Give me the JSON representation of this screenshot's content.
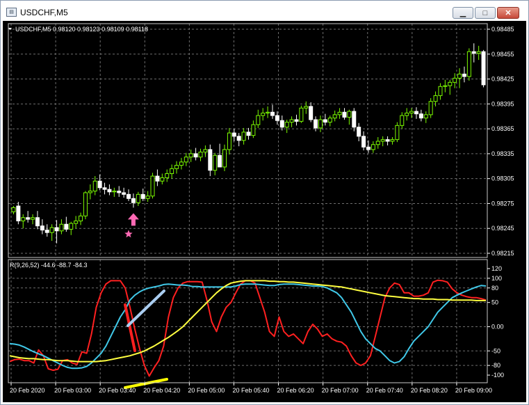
{
  "window": {
    "title": "USDCHF,M5",
    "buttons": [
      "minimize",
      "maximize",
      "close"
    ]
  },
  "main_header": "USDCHF,M5  0.98120 0.98123 0.98109 0.98118",
  "indicator_header": "R(9,26,52) -44.6 -88.7 -84.3",
  "colors": {
    "background": "#000000",
    "bull_candle": "#7cfc00",
    "bear_candle": "#ffffff",
    "grid": "#6e6e6e",
    "line_red": "#ff2020",
    "line_cyan": "#40c8e8",
    "line_yellow": "#ffff40",
    "arrow": "#ff69b4",
    "annot_red": "#ff2020",
    "annot_blue": "#aacdf0",
    "annot_yellow": "#ffff00"
  },
  "icons": {
    "arrow": "pink-up-arrow-icon",
    "star": "pink-star-icon",
    "dropdown": "triangle-down-icon"
  },
  "chart_data": [
    {
      "type": "candlestick",
      "symbol": "USDCHF",
      "timeframe": "M5",
      "ylim": [
        0.98215,
        0.98485
      ],
      "y_ticks": [
        "0.98485",
        "0.98455",
        "0.98425",
        "0.98395",
        "0.98365",
        "0.98335",
        "0.98305",
        "0.98275",
        "0.98245",
        "0.98215"
      ],
      "candles": [
        [
          0.98265,
          0.98272,
          0.98262,
          0.9827
        ],
        [
          0.98272,
          0.98277,
          0.9825,
          0.98254
        ],
        [
          0.98254,
          0.98262,
          0.98245,
          0.98258
        ],
        [
          0.98258,
          0.98266,
          0.98252,
          0.98256
        ],
        [
          0.98256,
          0.98262,
          0.9825,
          0.98258
        ],
        [
          0.98258,
          0.98266,
          0.98244,
          0.98248
        ],
        [
          0.98248,
          0.98256,
          0.98238,
          0.98243
        ],
        [
          0.98243,
          0.9825,
          0.98235,
          0.9824
        ],
        [
          0.9824,
          0.9825,
          0.9823,
          0.98246
        ],
        [
          0.98246,
          0.98255,
          0.98227,
          0.98242
        ],
        [
          0.98242,
          0.98256,
          0.98238,
          0.9825
        ],
        [
          0.9825,
          0.98259,
          0.98241,
          0.98244
        ],
        [
          0.98244,
          0.98253,
          0.98237,
          0.98251
        ],
        [
          0.98251,
          0.9826,
          0.98245,
          0.98254
        ],
        [
          0.98254,
          0.98264,
          0.98249,
          0.9826
        ],
        [
          0.9826,
          0.9829,
          0.98256,
          0.98288
        ],
        [
          0.98288,
          0.98298,
          0.9828,
          0.9829
        ],
        [
          0.9829,
          0.98308,
          0.98285,
          0.98302
        ],
        [
          0.98302,
          0.9831,
          0.98291,
          0.98294
        ],
        [
          0.98294,
          0.983,
          0.98286,
          0.98292
        ],
        [
          0.98292,
          0.98298,
          0.98285,
          0.98289
        ],
        [
          0.98289,
          0.98294,
          0.98283,
          0.9829
        ],
        [
          0.9829,
          0.98296,
          0.98283,
          0.98288
        ],
        [
          0.98288,
          0.98294,
          0.98282,
          0.98286
        ],
        [
          0.98286,
          0.98292,
          0.98278,
          0.98281
        ],
        [
          0.98281,
          0.98287,
          0.9827,
          0.98276
        ],
        [
          0.98276,
          0.98289,
          0.98272,
          0.98286
        ],
        [
          0.98286,
          0.98293,
          0.98278,
          0.98281
        ],
        [
          0.98281,
          0.9829,
          0.98277,
          0.98284
        ],
        [
          0.98284,
          0.98312,
          0.98281,
          0.98308
        ],
        [
          0.98308,
          0.98316,
          0.98296,
          0.98302
        ],
        [
          0.98302,
          0.98311,
          0.98298,
          0.98306
        ],
        [
          0.98306,
          0.98316,
          0.98301,
          0.98311
        ],
        [
          0.98311,
          0.98322,
          0.98305,
          0.98317
        ],
        [
          0.98317,
          0.98326,
          0.98311,
          0.98321
        ],
        [
          0.98321,
          0.9833,
          0.98316,
          0.98325
        ],
        [
          0.98325,
          0.98336,
          0.9832,
          0.98331
        ],
        [
          0.98331,
          0.9834,
          0.98325,
          0.98335
        ],
        [
          0.98335,
          0.98342,
          0.98327,
          0.98331
        ],
        [
          0.98331,
          0.98341,
          0.98326,
          0.98337
        ],
        [
          0.98337,
          0.98345,
          0.98331,
          0.9834
        ],
        [
          0.9834,
          0.98346,
          0.98308,
          0.98315
        ],
        [
          0.98315,
          0.98336,
          0.98309,
          0.98333
        ],
        [
          0.98333,
          0.98347,
          0.98324,
          0.98319
        ],
        [
          0.98319,
          0.98346,
          0.98314,
          0.9834
        ],
        [
          0.9834,
          0.98366,
          0.98334,
          0.9836
        ],
        [
          0.9836,
          0.98365,
          0.9835,
          0.98356
        ],
        [
          0.98356,
          0.9836,
          0.98344,
          0.98351
        ],
        [
          0.98351,
          0.98366,
          0.98346,
          0.98361
        ],
        [
          0.98361,
          0.98366,
          0.98352,
          0.98357
        ],
        [
          0.98357,
          0.98375,
          0.98354,
          0.9837
        ],
        [
          0.9837,
          0.98388,
          0.98366,
          0.98381
        ],
        [
          0.98381,
          0.9839,
          0.98375,
          0.98384
        ],
        [
          0.98384,
          0.98392,
          0.98378,
          0.98385
        ],
        [
          0.98385,
          0.98394,
          0.98377,
          0.98381
        ],
        [
          0.98381,
          0.98386,
          0.9837,
          0.98375
        ],
        [
          0.98375,
          0.98381,
          0.98363,
          0.98367
        ],
        [
          0.98367,
          0.98376,
          0.9836,
          0.98373
        ],
        [
          0.98373,
          0.9838,
          0.98367,
          0.98376
        ],
        [
          0.98376,
          0.98382,
          0.98369,
          0.98374
        ],
        [
          0.98374,
          0.98393,
          0.98372,
          0.9839
        ],
        [
          0.9839,
          0.98398,
          0.98383,
          0.98392
        ],
        [
          0.98392,
          0.98397,
          0.98373,
          0.98376
        ],
        [
          0.98376,
          0.9838,
          0.98362,
          0.98366
        ],
        [
          0.98366,
          0.98381,
          0.98361,
          0.98376
        ],
        [
          0.98376,
          0.98383,
          0.98369,
          0.98373
        ],
        [
          0.98373,
          0.98381,
          0.98368,
          0.98378
        ],
        [
          0.98378,
          0.98387,
          0.98374,
          0.98382
        ],
        [
          0.98382,
          0.9839,
          0.98377,
          0.98385
        ],
        [
          0.98385,
          0.9839,
          0.98376,
          0.98379
        ],
        [
          0.98379,
          0.98388,
          0.9837,
          0.98386
        ],
        [
          0.98386,
          0.9839,
          0.98362,
          0.98367
        ],
        [
          0.98367,
          0.98372,
          0.9835,
          0.98356
        ],
        [
          0.98356,
          0.98362,
          0.98339,
          0.98343
        ],
        [
          0.98343,
          0.98351,
          0.98336,
          0.9834
        ],
        [
          0.9834,
          0.9835,
          0.98336,
          0.98346
        ],
        [
          0.98346,
          0.98355,
          0.98341,
          0.9835
        ],
        [
          0.9835,
          0.98356,
          0.98344,
          0.98352
        ],
        [
          0.98352,
          0.98356,
          0.98345,
          0.9835
        ],
        [
          0.9835,
          0.98355,
          0.98346,
          0.98352
        ],
        [
          0.98352,
          0.98373,
          0.98349,
          0.98369
        ],
        [
          0.98369,
          0.98385,
          0.98365,
          0.98381
        ],
        [
          0.98381,
          0.9839,
          0.98375,
          0.98384
        ],
        [
          0.98384,
          0.9839,
          0.98378,
          0.98386
        ],
        [
          0.98386,
          0.98391,
          0.98377,
          0.98383
        ],
        [
          0.98383,
          0.98388,
          0.98374,
          0.98378
        ],
        [
          0.98378,
          0.98386,
          0.98372,
          0.98382
        ],
        [
          0.98382,
          0.98402,
          0.98378,
          0.98398
        ],
        [
          0.98398,
          0.9841,
          0.98392,
          0.98405
        ],
        [
          0.98405,
          0.9842,
          0.984,
          0.98416
        ],
        [
          0.98416,
          0.98424,
          0.98409,
          0.98417
        ],
        [
          0.98417,
          0.98424,
          0.98406,
          0.98421
        ],
        [
          0.98421,
          0.98432,
          0.98414,
          0.98426
        ],
        [
          0.98426,
          0.98438,
          0.98414,
          0.98431
        ],
        [
          0.98431,
          0.9844,
          0.98421,
          0.98428
        ],
        [
          0.98428,
          0.98462,
          0.98423,
          0.98458
        ],
        [
          0.98458,
          0.98468,
          0.98445,
          0.98456
        ],
        [
          0.98456,
          0.98465,
          0.98448,
          0.98458
        ],
        [
          0.98458,
          0.9846,
          0.98415,
          0.98418
        ]
      ],
      "arrow_index": 25
    },
    {
      "type": "line",
      "title": "R(9,26,52)",
      "ylim": [
        -110,
        130
      ],
      "y_ticks": [
        "120",
        "100",
        "80",
        "50",
        "0.00",
        "-50",
        "-80",
        "-100"
      ],
      "series": [
        {
          "name": "9",
          "values": [
            -72,
            -68,
            -67,
            -70,
            -70,
            -75,
            -48,
            -60,
            -87,
            -90,
            -88,
            -70,
            -68,
            -75,
            -78,
            -52,
            -55,
            -15,
            40,
            70,
            88,
            95,
            95,
            95,
            80,
            40,
            -5,
            -45,
            -80,
            -102,
            -85,
            -70,
            -40,
            20,
            60,
            80,
            90,
            93,
            93,
            93,
            92,
            55,
            10,
            -10,
            20,
            40,
            50,
            70,
            88,
            95,
            95,
            90,
            60,
            30,
            -10,
            -20,
            20,
            -10,
            -20,
            -15,
            -25,
            -35,
            -10,
            5,
            -5,
            -20,
            -15,
            -25,
            -30,
            -32,
            -40,
            -60,
            -75,
            -80,
            -75,
            -60,
            -20,
            20,
            60,
            80,
            90,
            87,
            70,
            70,
            63,
            63,
            65,
            70,
            92,
            96,
            95,
            92,
            78,
            70,
            65,
            62,
            60,
            60,
            58,
            55
          ]
        },
        {
          "name": "26",
          "values": [
            -35,
            -36,
            -38,
            -42,
            -47,
            -52,
            -56,
            -60,
            -65,
            -70,
            -75,
            -80,
            -84,
            -86,
            -86,
            -85,
            -82,
            -75,
            -65,
            -55,
            -40,
            -20,
            0,
            20,
            35,
            55,
            65,
            72,
            77,
            80,
            82,
            84,
            87,
            88,
            87,
            86,
            86,
            85,
            83,
            83,
            82,
            82,
            82,
            82,
            82,
            82,
            82,
            84,
            87,
            88,
            88,
            88,
            87,
            86,
            85,
            85,
            87,
            88,
            88,
            88,
            87,
            86,
            85,
            84,
            84,
            83,
            80,
            75,
            70,
            60,
            45,
            30,
            10,
            -10,
            -25,
            -35,
            -45,
            -50,
            -60,
            -70,
            -75,
            -72,
            -62,
            -45,
            -30,
            -20,
            -10,
            0,
            15,
            30,
            40,
            50,
            60,
            65,
            70,
            74,
            78,
            82,
            85,
            84
          ]
        },
        {
          "name": "52",
          "values": [
            -60,
            -62,
            -64,
            -65,
            -66,
            -66,
            -67,
            -68,
            -68,
            -69,
            -70,
            -70,
            -70,
            -71,
            -72,
            -72,
            -72,
            -72,
            -72,
            -71,
            -70,
            -68,
            -66,
            -64,
            -62,
            -60,
            -57,
            -54,
            -50,
            -45,
            -40,
            -34,
            -28,
            -22,
            -15,
            -8,
            0,
            10,
            20,
            30,
            40,
            50,
            60,
            70,
            78,
            85,
            90,
            92,
            94,
            95,
            95,
            95,
            95,
            95,
            94,
            94,
            93,
            93,
            92,
            92,
            91,
            90,
            89,
            88,
            87,
            86,
            85,
            84,
            83,
            82,
            80,
            78,
            76,
            74,
            72,
            70,
            68,
            66,
            64,
            63,
            62,
            61,
            60,
            59,
            58,
            58,
            57,
            57,
            57,
            56,
            56,
            56,
            55,
            55,
            55,
            55,
            55,
            54,
            54,
            54
          ]
        }
      ]
    }
  ],
  "x_ticks": [
    "20 Feb 2020",
    "20 Feb 03:00",
    "20 Feb 03:40",
    "20 Feb 04:20",
    "20 Feb 05:00",
    "20 Feb 05:40",
    "20 Feb 06:20",
    "20 Feb 07:00",
    "20 Feb 07:40",
    "20 Feb 08:20",
    "20 Feb 09:00"
  ]
}
